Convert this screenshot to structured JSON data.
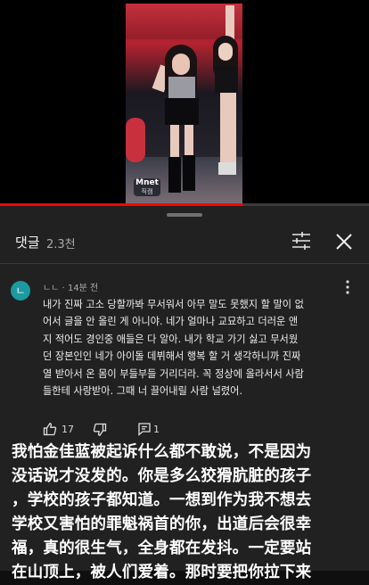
{
  "video": {
    "logo_text": "Mnet",
    "logo_sub": "직캠",
    "progress": 0.66
  },
  "comments_header": {
    "title": "댓글",
    "count": "2.3천"
  },
  "icons": {
    "filter": "sliders-icon",
    "close": "close-icon",
    "more": "more-vert-icon",
    "like": "thumb-up-icon",
    "dislike": "thumb-down-icon",
    "reply": "reply-icon"
  },
  "comment": {
    "avatar_letter": "ㄴ",
    "author": "ㄴㄴ",
    "time": "14분 전",
    "lines": [
      "내가 진짜 고소 당할까봐 무서워서 아무 말도 못했지 할 말이 없",
      "어서 글을 안 올린 게 아니야. 네가 얼마나 교묘하고 더러운 앤",
      "지 적어도 경인중 애들은 다 알아. 내가 학교 가기 싫고 무서웠",
      "던 장본인인 네가 아이돌 데뷔해서 행복 할 거 생각하니까 진짜",
      "열 받아서 온 몸이 부들부들 거리더라. 꼭 정상에 올라서서 사람",
      "들한테 사랑받아. 그때 너 끌어내릴 사람 널렸어."
    ],
    "like_count": "17",
    "reply_count": "1"
  },
  "colors": {
    "background": "#0f0f0f",
    "sheet": "#212121",
    "progress": "#ff0000",
    "avatar": "#1b9aa0"
  },
  "overlay": {
    "lines": [
      "我怕金佳蓝被起诉什么都不敢说，不是因为",
      "没话说才没发的。你是多么狡猾肮脏的孩子",
      "，学校的孩子都知道。一想到作为我不想去",
      "学校又害怕的罪魁祸首的你，出道后会很幸",
      "福，真的很生气，全身都在发抖。一定要站",
      "在山顶上，被人们爱着。那时要把你拉下来"
    ]
  }
}
